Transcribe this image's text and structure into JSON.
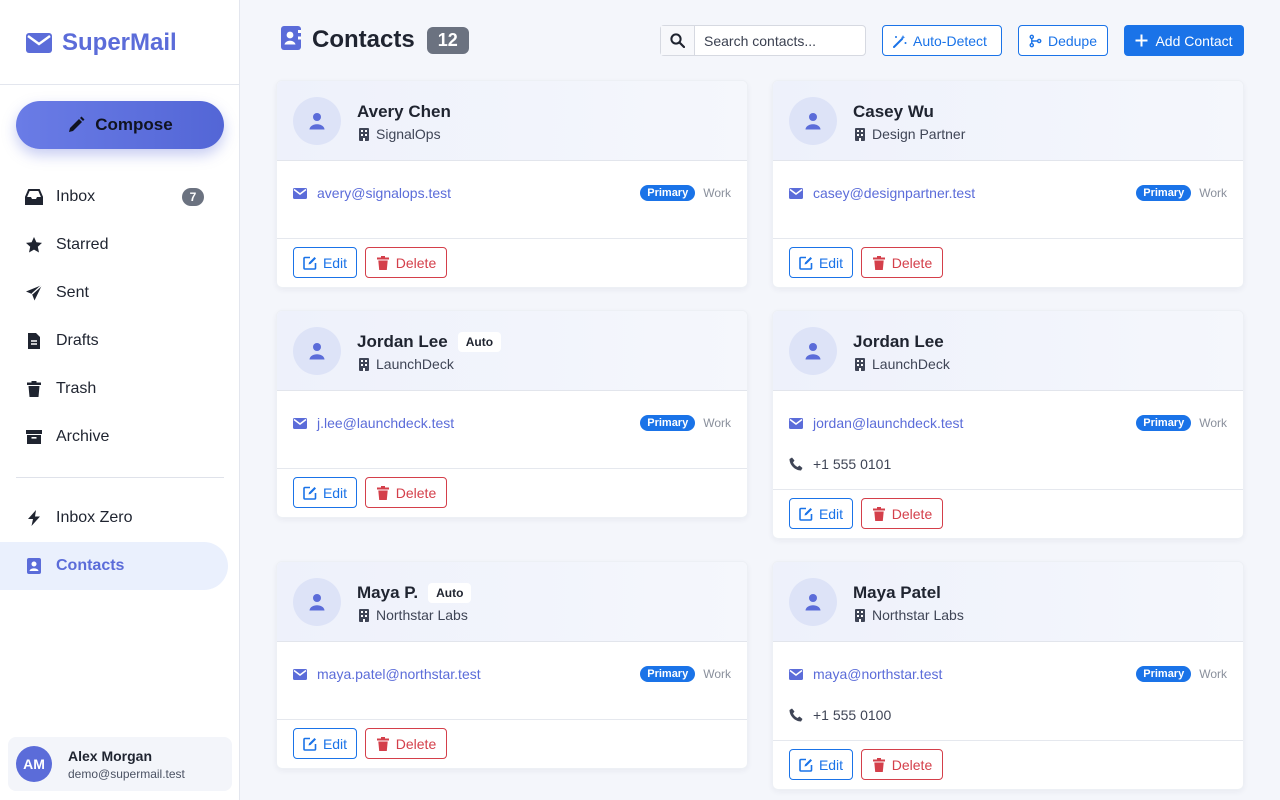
{
  "app": {
    "brand": "SuperMail",
    "compose_label": "Compose"
  },
  "nav": {
    "items": [
      {
        "label": "Inbox",
        "icon": "inbox-icon",
        "count": "7"
      },
      {
        "label": "Starred",
        "icon": "star-icon"
      },
      {
        "label": "Sent",
        "icon": "send-icon"
      },
      {
        "label": "Drafts",
        "icon": "draft-icon"
      },
      {
        "label": "Trash",
        "icon": "trash-icon"
      },
      {
        "label": "Archive",
        "icon": "archive-icon"
      },
      {
        "label": "Inbox Zero",
        "icon": "bolt-icon"
      },
      {
        "label": "Contacts",
        "icon": "contacts-icon",
        "active": true
      }
    ]
  },
  "user": {
    "initials": "AM",
    "name": "Alex Morgan",
    "email": "demo@supermail.test"
  },
  "header": {
    "title": "Contacts",
    "count": "12",
    "search_placeholder": "Search contacts...",
    "auto_detect_label": "Auto-Detect",
    "dedupe_label": "Dedupe",
    "add_contact_label": "Add Contact"
  },
  "labels": {
    "primary": "Primary",
    "work": "Work",
    "edit": "Edit",
    "delete": "Delete",
    "auto": "Auto"
  },
  "contacts": [
    {
      "name": "Avery Chen",
      "company": "SignalOps",
      "email": "avery@signalops.test",
      "phone": "",
      "auto": false
    },
    {
      "name": "Casey Wu",
      "company": "Design Partner",
      "email": "casey@designpartner.test",
      "phone": "",
      "auto": false
    },
    {
      "name": "Jordan Lee",
      "company": "LaunchDeck",
      "email": "j.lee@launchdeck.test",
      "phone": "",
      "auto": true
    },
    {
      "name": "Jordan Lee",
      "company": "LaunchDeck",
      "email": "jordan@launchdeck.test",
      "phone": "+1 555 0101",
      "auto": false
    },
    {
      "name": "Maya P.",
      "company": "Northstar Labs",
      "email": "maya.patel@northstar.test",
      "phone": "",
      "auto": true
    },
    {
      "name": "Maya Patel",
      "company": "Northstar Labs",
      "email": "maya@northstar.test",
      "phone": "+1 555 0100",
      "auto": false
    }
  ],
  "colors": {
    "accent": "#5b6cd9",
    "primary_blue": "#1a73e8",
    "danger": "#d43f4a"
  }
}
